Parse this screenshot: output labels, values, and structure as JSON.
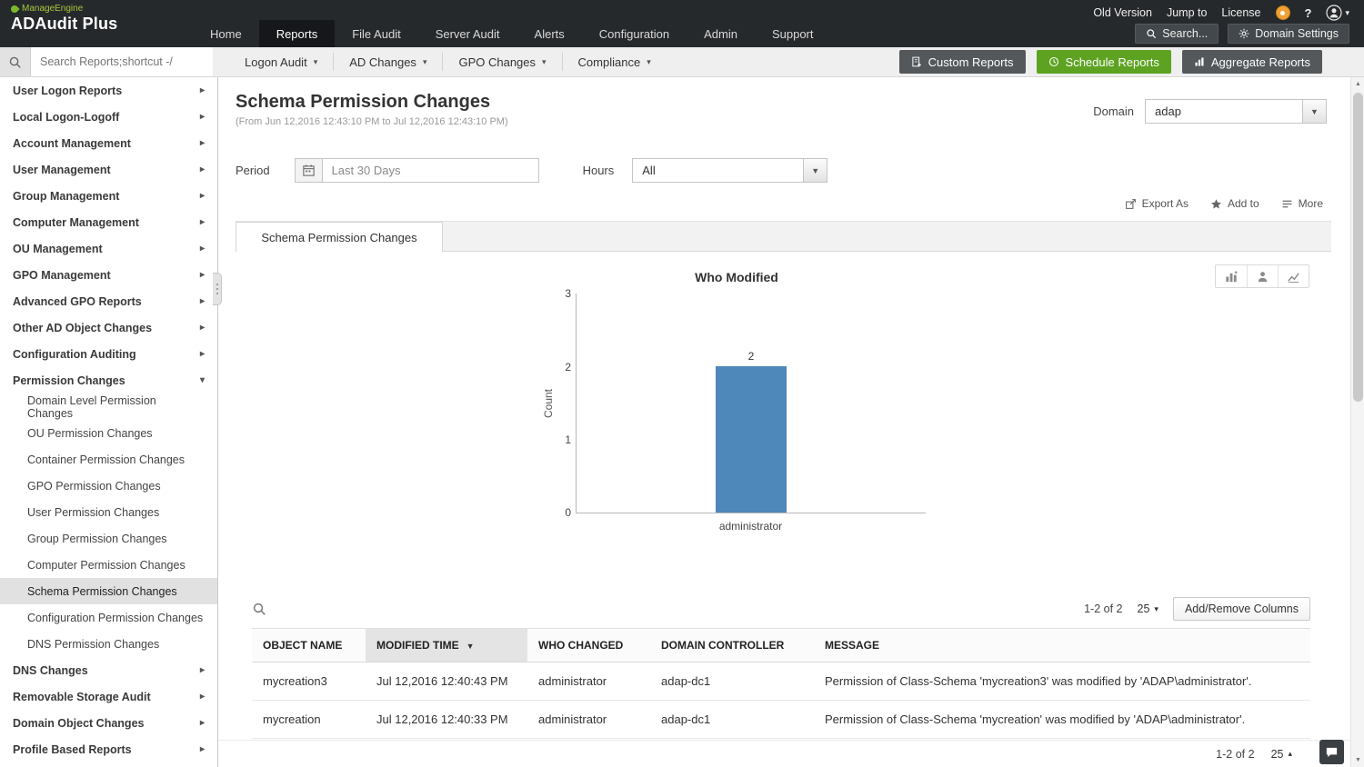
{
  "app": {
    "brand_small": "ManageEngine",
    "brand": "ADAudit Plus"
  },
  "header": {
    "nav": [
      {
        "label": "Home"
      },
      {
        "label": "Reports"
      },
      {
        "label": "File Audit"
      },
      {
        "label": "Server Audit"
      },
      {
        "label": "Alerts"
      },
      {
        "label": "Configuration"
      },
      {
        "label": "Admin"
      },
      {
        "label": "Support"
      }
    ],
    "active_nav": "Reports",
    "links": {
      "old_version": "Old Version",
      "jump_to": "Jump to",
      "license": "License"
    },
    "search_button": "Search...",
    "domain_settings_button": "Domain Settings"
  },
  "toolbar": {
    "search_placeholder": "Search Reports;shortcut -/",
    "menus": [
      {
        "label": "Logon Audit"
      },
      {
        "label": "AD Changes"
      },
      {
        "label": "GPO Changes"
      },
      {
        "label": "Compliance"
      }
    ],
    "buttons": {
      "custom_reports": "Custom Reports",
      "schedule_reports": "Schedule Reports",
      "aggregate_reports": "Aggregate Reports"
    },
    "accent_green": "#5da321"
  },
  "sidebar": {
    "items_top": [
      {
        "label": "User Logon Reports"
      },
      {
        "label": "Local Logon-Logoff"
      },
      {
        "label": "Account Management"
      },
      {
        "label": "User Management"
      },
      {
        "label": "Group Management"
      },
      {
        "label": "Computer Management"
      },
      {
        "label": "OU Management"
      },
      {
        "label": "GPO Management"
      },
      {
        "label": "Advanced GPO Reports"
      },
      {
        "label": "Other AD Object Changes"
      },
      {
        "label": "Configuration Auditing"
      }
    ],
    "expanded_item": {
      "label": "Permission Changes"
    },
    "children": [
      {
        "label": "Domain Level Permission Changes"
      },
      {
        "label": "OU Permission Changes"
      },
      {
        "label": "Container Permission Changes"
      },
      {
        "label": "GPO Permission Changes"
      },
      {
        "label": "User Permission Changes"
      },
      {
        "label": "Group Permission Changes"
      },
      {
        "label": "Computer Permission Changes"
      },
      {
        "label": "Schema Permission Changes"
      },
      {
        "label": "Configuration Permission Changes"
      },
      {
        "label": "DNS Permission Changes"
      }
    ],
    "selected_child": "Schema Permission Changes",
    "items_bottom": [
      {
        "label": "DNS Changes"
      },
      {
        "label": "Removable Storage Audit"
      },
      {
        "label": "Domain Object Changes"
      },
      {
        "label": "Profile Based Reports"
      }
    ]
  },
  "main": {
    "title": "Schema Permission Changes",
    "subtitle": "(From Jun 12,2016 12:43:10 PM to Jul 12,2016 12:43:10 PM)",
    "domain": {
      "label": "Domain",
      "value": "adap"
    },
    "filters": {
      "period_label": "Period",
      "period_value": "Last 30 Days",
      "hours_label": "Hours",
      "hours_value": "All"
    },
    "actions": {
      "export_as": "Export As",
      "add_to": "Add to",
      "more": "More"
    },
    "tab": "Schema Permission Changes",
    "chart_data": {
      "type": "bar",
      "title": "Who Modified",
      "categories": [
        "administrator"
      ],
      "values": [
        2
      ],
      "ylabel": "Count",
      "ylim": [
        0,
        3
      ],
      "yticks": [
        0,
        1,
        2,
        3
      ],
      "bar_color": "#4e87b9",
      "grid": false,
      "legend": false,
      "data_labels": true
    },
    "table": {
      "columns": [
        {
          "label": "OBJECT NAME"
        },
        {
          "label": "MODIFIED TIME",
          "sorted": "desc"
        },
        {
          "label": "WHO CHANGED"
        },
        {
          "label": "DOMAIN CONTROLLER"
        },
        {
          "label": "MESSAGE"
        }
      ],
      "rows": [
        [
          "mycreation3",
          "Jul 12,2016 12:40:43 PM",
          "administrator",
          "adap-dc1",
          "Permission of Class-Schema 'mycreation3' was modified by 'ADAP\\administrator'."
        ],
        [
          "mycreation",
          "Jul 12,2016 12:40:33 PM",
          "administrator",
          "adap-dc1",
          "Permission of Class-Schema 'mycreation' was modified by 'ADAP\\administrator'."
        ]
      ],
      "pagination": "1-2 of 2",
      "page_size": "25",
      "add_remove_columns_button": "Add/Remove Columns"
    },
    "footer": {
      "pagination": "1-2 of 2",
      "page_size": "25"
    }
  }
}
